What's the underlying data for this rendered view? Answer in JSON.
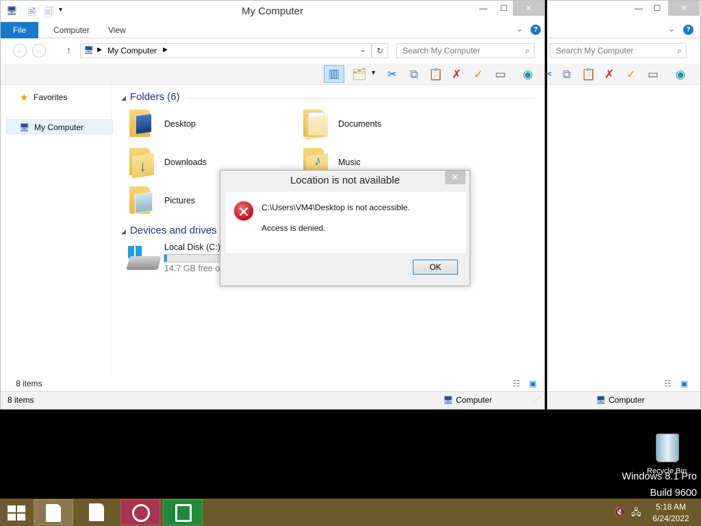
{
  "main_window": {
    "title": "My Computer",
    "tabs": {
      "file": "File",
      "computer": "Computer",
      "view": "View"
    },
    "address": "My Computer",
    "search_placeholder": "Search My Computer",
    "nav": {
      "favorites": "Favorites",
      "my_computer": "My Computer"
    },
    "folders_header": "Folders (6)",
    "folders": [
      {
        "label": "Desktop"
      },
      {
        "label": "Documents"
      },
      {
        "label": "Downloads"
      },
      {
        "label": "Music"
      },
      {
        "label": "Pictures"
      }
    ],
    "drives_header": "Devices and drives (",
    "drive": {
      "label": "Local Disk (C:)",
      "free": "14.7 GB free of",
      "used_fraction": 0.02
    },
    "item_count": "8 items",
    "status_count": "8 items",
    "status_location": "Computer"
  },
  "second_window": {
    "search_placeholder": "Search My Computer",
    "status_location": "Computer"
  },
  "dialog": {
    "title": "Location is not available",
    "message": "C:\\Users\\VM4\\Desktop is not accessible.",
    "detail": "Access is denied.",
    "ok_label": "OK",
    "close_label": "✕"
  },
  "desktop": {
    "recycle_bin": "Recycle Bin",
    "watermark_line1": "Windows 8.1 Pro",
    "watermark_line2": "Build 9600"
  },
  "taskbar": {
    "time": "5:18 AM",
    "date": "6/24/2022"
  },
  "colors": {
    "accent": "#1979ca",
    "taskbar": "#6c5a2a",
    "folder_header": "#1e3287"
  }
}
